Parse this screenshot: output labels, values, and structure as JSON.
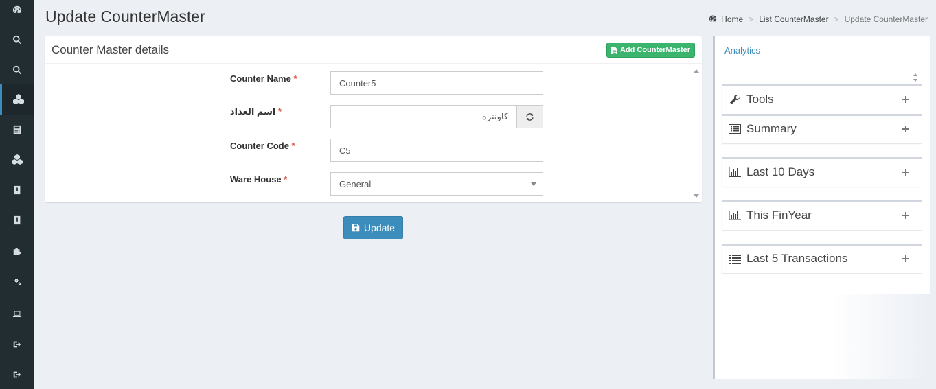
{
  "page": {
    "title": "Update CounterMaster"
  },
  "breadcrumb": {
    "home": "Home",
    "list": "List CounterMaster",
    "current": "Update CounterMaster"
  },
  "sidebar": {
    "icons": [
      "dashboard-icon",
      "search-icon",
      "search-icon",
      "cubes-icon",
      "calculator-icon",
      "cubes-icon",
      "book-icon",
      "book-icon",
      "puzzle-icon",
      "cogs-icon",
      "laptop-icon",
      "sign-out-icon",
      "sign-out-icon"
    ],
    "active_index": 3
  },
  "box": {
    "title": "Counter Master details",
    "add_button": "Add CounterMaster"
  },
  "form": {
    "counter_name": {
      "label": "Counter Name",
      "required": "*",
      "value": "Counter5"
    },
    "arabic_name": {
      "label": "اسم العداد",
      "required": "*",
      "value": "كاونتره"
    },
    "counter_code": {
      "label": "Counter Code",
      "required": "*",
      "value": "C5"
    },
    "ware_house": {
      "label": "Ware House",
      "required": "*",
      "value": "General"
    },
    "update_button": "Update"
  },
  "right_panel": {
    "analytics_link": "Analytics",
    "widgets": [
      {
        "title": "Tools",
        "icon": "wrench-icon"
      },
      {
        "title": "Summary",
        "icon": "list-alt-icon"
      },
      {
        "title": "Last 10 Days",
        "icon": "bar-chart-icon"
      },
      {
        "title": "This FinYear",
        "icon": "bar-chart-icon"
      },
      {
        "title": "Last 5 Transactions",
        "icon": "list-icon"
      }
    ]
  },
  "colors": {
    "sidebar": "#222d32",
    "accent": "#3c8dbc",
    "success": "#3bb46e",
    "required": "#dd4b39"
  }
}
